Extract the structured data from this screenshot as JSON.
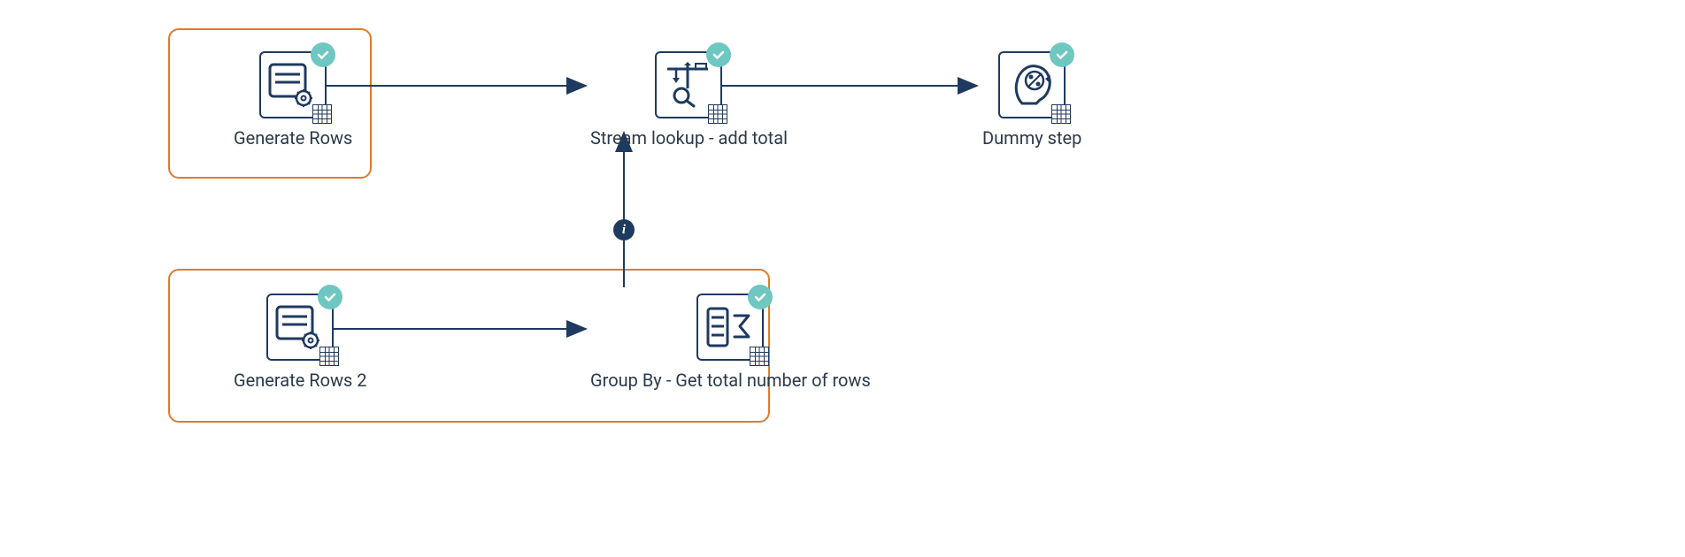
{
  "nodes": {
    "generate_rows": {
      "label": "Generate Rows",
      "status": "success",
      "icon": "generate-rows-icon"
    },
    "stream_lookup": {
      "label": "Stream lookup - add total",
      "status": "success",
      "icon": "stream-lookup-icon"
    },
    "dummy_step": {
      "label": "Dummy step",
      "status": "success",
      "icon": "dummy-step-icon"
    },
    "generate_rows_2": {
      "label": "Generate Rows 2",
      "status": "success",
      "icon": "generate-rows-icon"
    },
    "group_by": {
      "label": "Group By - Get total number of rows",
      "status": "success",
      "icon": "group-by-icon"
    }
  },
  "edges": [
    {
      "from": "generate_rows",
      "to": "stream_lookup"
    },
    {
      "from": "stream_lookup",
      "to": "dummy_step"
    },
    {
      "from": "generate_rows_2",
      "to": "group_by"
    },
    {
      "from": "group_by",
      "to": "stream_lookup",
      "marker": "info"
    }
  ],
  "highlights": [
    {
      "around": [
        "generate_rows"
      ]
    },
    {
      "around": [
        "generate_rows_2",
        "group_by"
      ]
    }
  ],
  "info_badge_text": "i",
  "colors": {
    "stroke": "#1f3a5f",
    "highlight": "#e07b2c",
    "status_badge": "#6ec7c0"
  }
}
